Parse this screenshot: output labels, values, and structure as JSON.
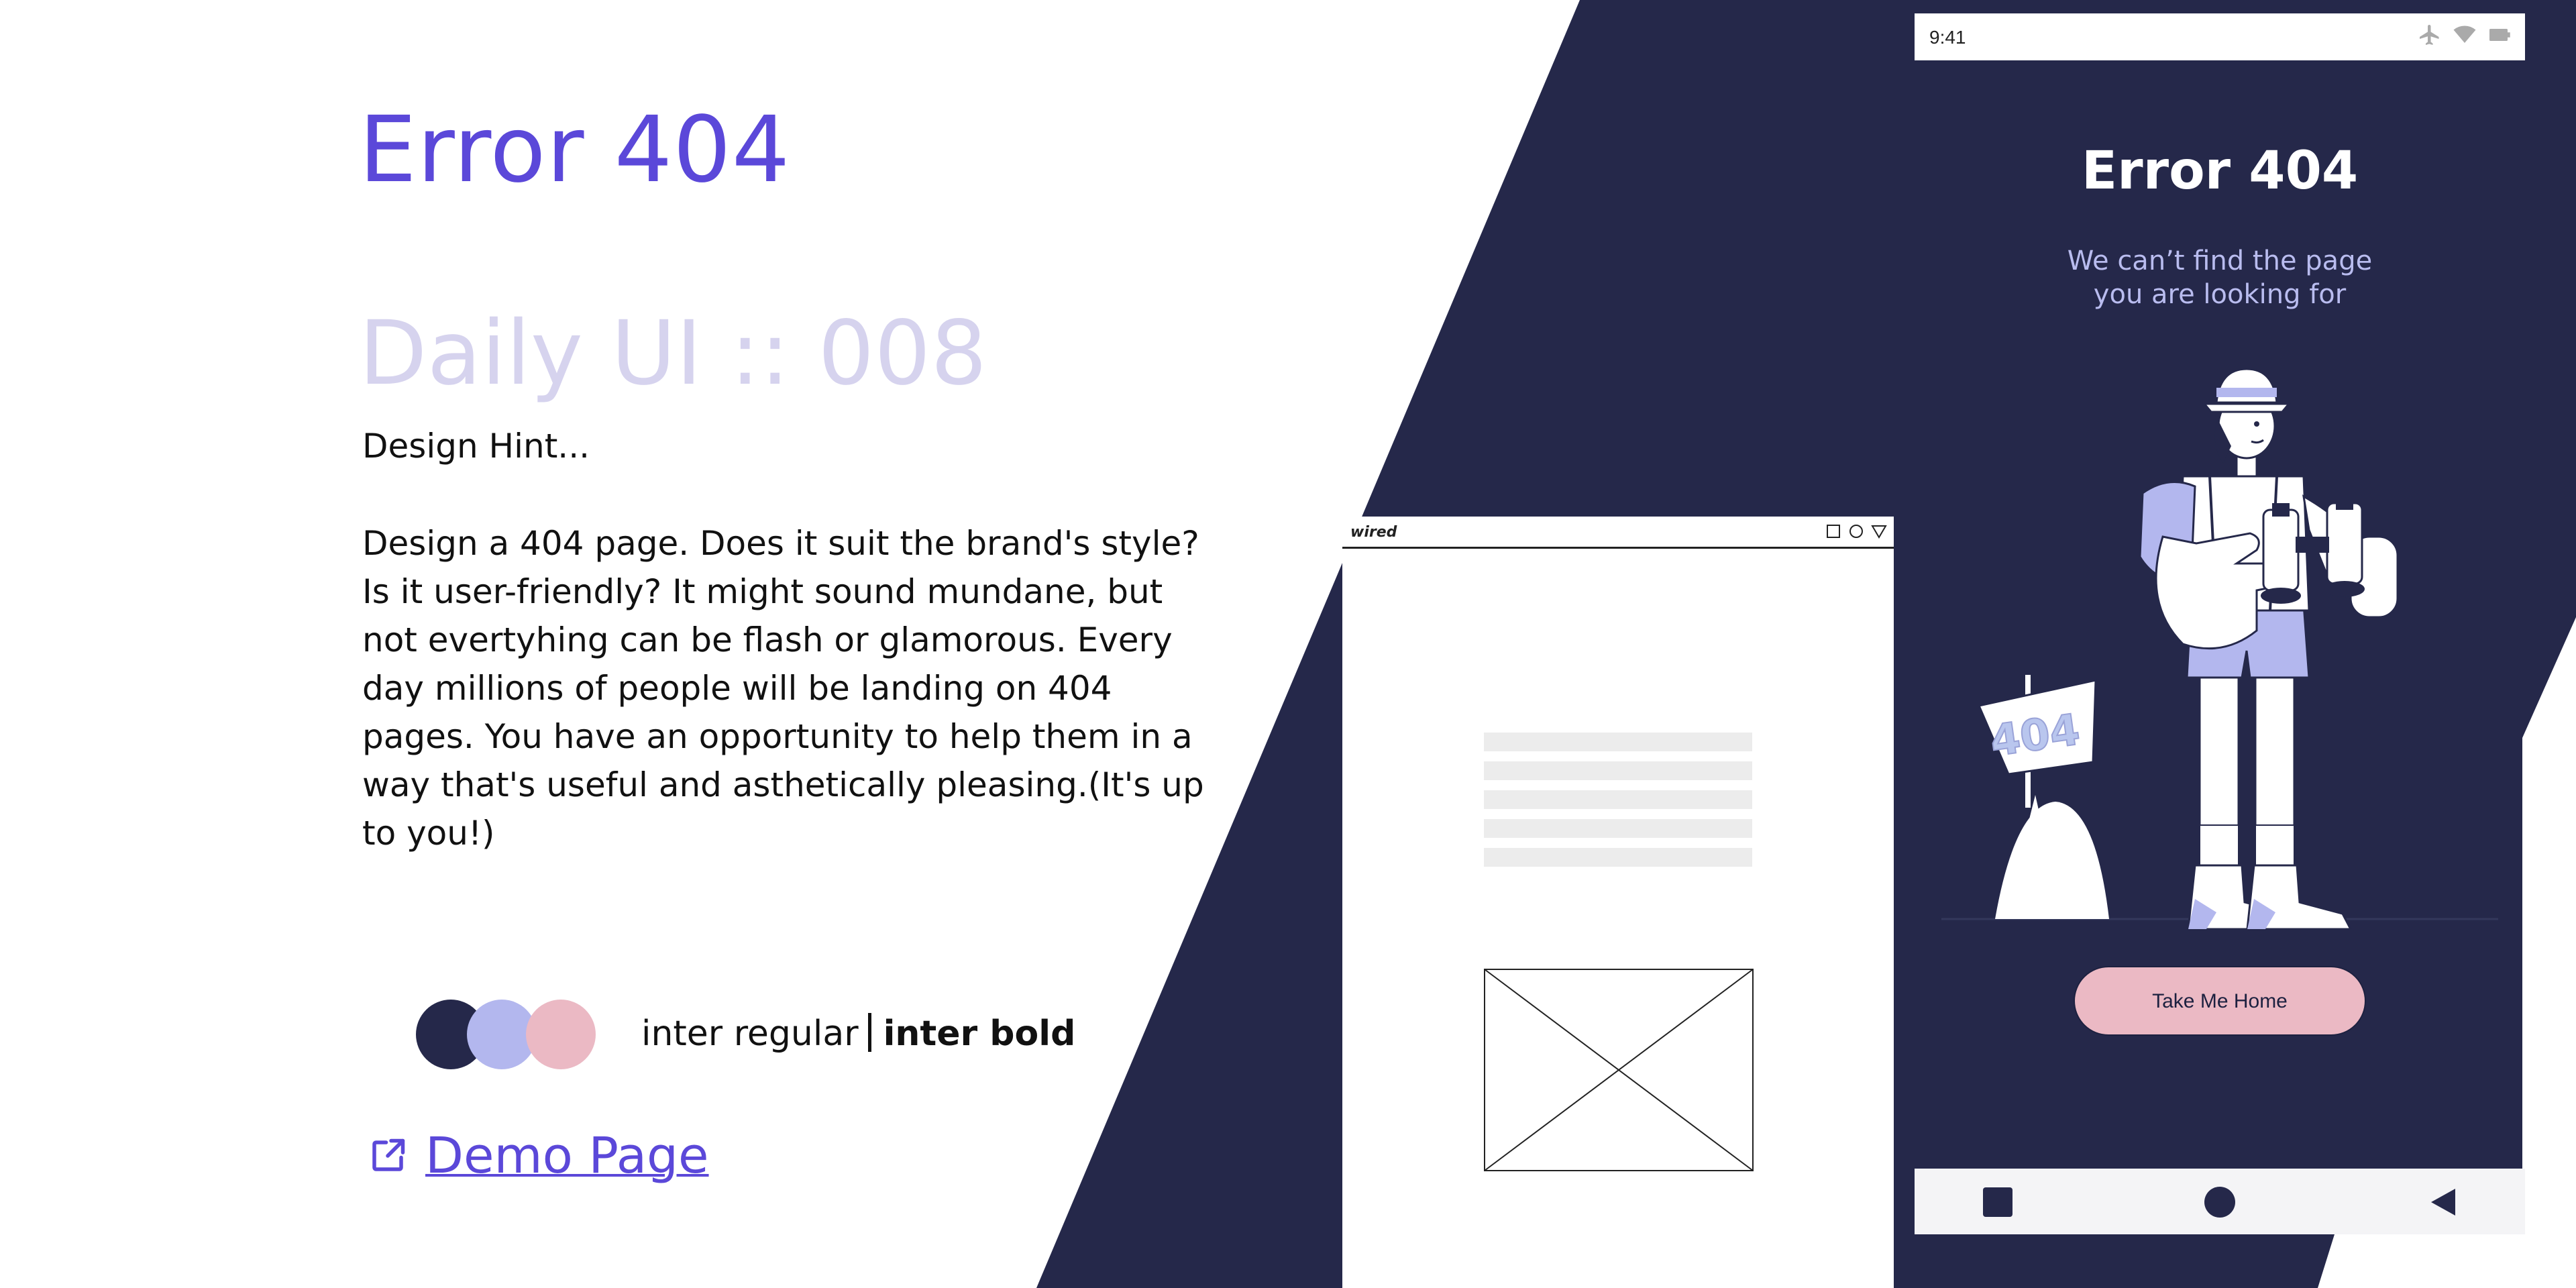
{
  "left": {
    "title": "Error 404",
    "challenge": "Daily UI :: 008",
    "hint_title": "Design Hint...",
    "hint_body": "Design a 404 page. Does it suit the brand's style? Is it user-friendly? It might sound mundane, but not evertyhing can be flash or glamorous. Every day millions of people will be landing on 404 pages. You have an opportunity to help them in a way that's useful and asthetically pleasing.(It's up to you!)",
    "palette": [
      "#ffffff",
      "#25284a",
      "#b3b7ee",
      "#ebb9c4"
    ],
    "font_regular": "inter regular",
    "font_bold": "inter bold",
    "demo_link": "Demo Page",
    "demo_icon": "external-link-icon"
  },
  "wireframe": {
    "logo": "wired",
    "controls": [
      "square-icon",
      "circle-icon",
      "triangle-icon"
    ]
  },
  "phone": {
    "status_time": "9:41",
    "status_icons": [
      "airplane-icon",
      "wifi-icon",
      "battery-icon"
    ],
    "title": "Error 404",
    "subtitle_line1": "We can’t find the page",
    "subtitle_line2": "you are looking for",
    "sign_text": "404",
    "button_label": "Take Me Home",
    "nav": [
      "recents-square-icon",
      "home-circle-icon",
      "back-triangle-icon"
    ]
  },
  "colors": {
    "accent": "#5b48d9",
    "muted_title": "#d6d3ee",
    "navy": "#25284a",
    "lavender": "#b3b7ee",
    "pink": "#ebb9c4"
  }
}
